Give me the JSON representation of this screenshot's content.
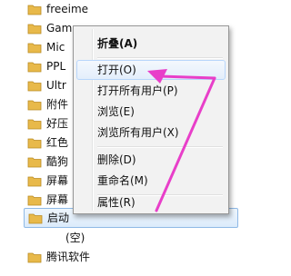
{
  "tree": {
    "items": [
      {
        "label": "freeime"
      },
      {
        "label": "Games"
      },
      {
        "label": "Mic"
      },
      {
        "label": "PPL"
      },
      {
        "label": "Ultr"
      },
      {
        "label": "附件"
      },
      {
        "label": "好压"
      },
      {
        "label": "红色"
      },
      {
        "label": "酷狗"
      },
      {
        "label": "屏幕"
      },
      {
        "label": "屏幕"
      },
      {
        "label": "启动"
      }
    ],
    "empty_label": "(空)",
    "last_item": {
      "label": "腾讯软件"
    }
  },
  "context_menu": {
    "items": [
      {
        "label": "折叠(A)"
      },
      {
        "label": "打开(O)"
      },
      {
        "label": "打开所有用户(P)"
      },
      {
        "label": "浏览(E)"
      },
      {
        "label": "浏览所有用户(X)"
      },
      {
        "label": "删除(D)"
      },
      {
        "label": "重命名(M)"
      },
      {
        "label": "属性(R)"
      }
    ]
  },
  "colors": {
    "folder": "#e8b94a",
    "arrow": "#e83fc9",
    "selection": "#dcebfb"
  }
}
